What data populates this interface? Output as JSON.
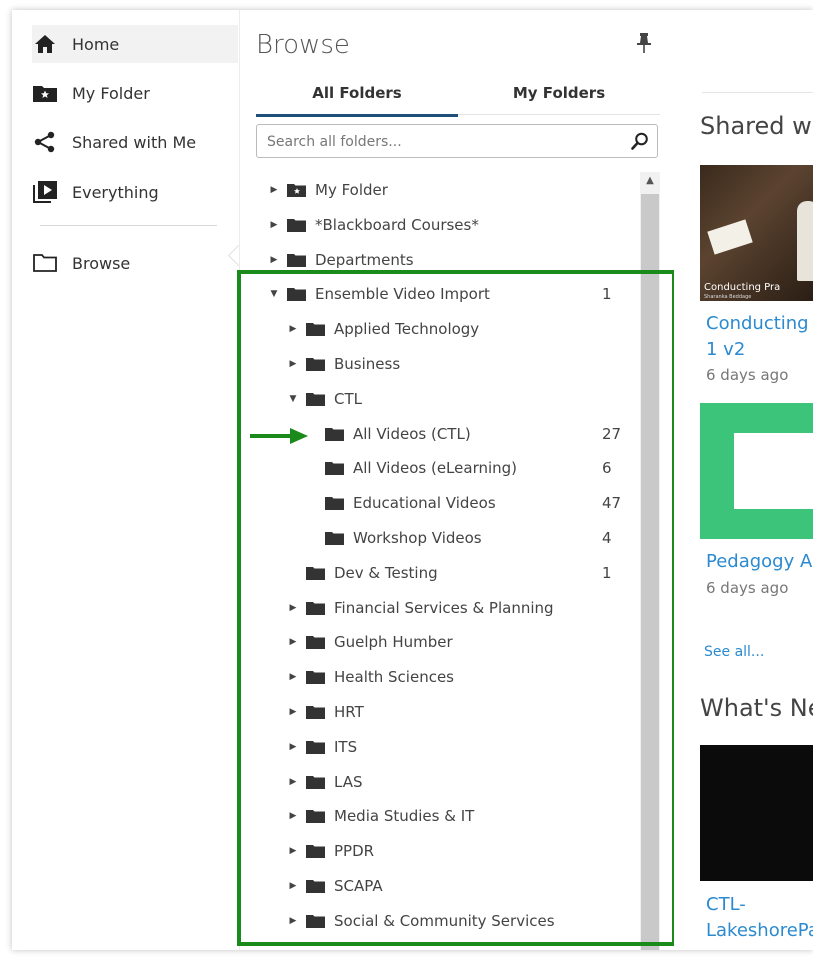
{
  "nav": {
    "items": [
      {
        "label": "Home",
        "icon": "home-icon"
      },
      {
        "label": "My Folder",
        "icon": "star-folder-icon"
      },
      {
        "label": "Shared with Me",
        "icon": "share-icon"
      },
      {
        "label": "Everything",
        "icon": "video-library-icon"
      },
      {
        "label": "Browse",
        "icon": "folder-outline-icon"
      }
    ]
  },
  "panel": {
    "title": "Browse",
    "tabs": [
      {
        "label": "All Folders",
        "active": true
      },
      {
        "label": "My Folders",
        "active": false
      }
    ],
    "search_placeholder": "Search all folders..."
  },
  "tree": [
    {
      "label": "My Folder",
      "count": "",
      "expander": "collapsed",
      "depth": 0,
      "star": true
    },
    {
      "label": "*Blackboard Courses*",
      "count": "",
      "expander": "collapsed",
      "depth": 0
    },
    {
      "label": "Departments",
      "count": "",
      "expander": "collapsed",
      "depth": 0
    },
    {
      "label": "Ensemble Video Import",
      "count": "1",
      "expander": "expanded",
      "depth": 0
    },
    {
      "label": "Applied Technology",
      "count": "",
      "expander": "collapsed",
      "depth": 1
    },
    {
      "label": "Business",
      "count": "",
      "expander": "collapsed",
      "depth": 1
    },
    {
      "label": "CTL",
      "count": "",
      "expander": "expanded",
      "depth": 1
    },
    {
      "label": "All Videos (CTL)",
      "count": "27",
      "expander": "none",
      "depth": 2
    },
    {
      "label": "All Videos (eLearning)",
      "count": "6",
      "expander": "none",
      "depth": 2
    },
    {
      "label": "Educational Videos",
      "count": "47",
      "expander": "none",
      "depth": 2
    },
    {
      "label": "Workshop Videos",
      "count": "4",
      "expander": "none",
      "depth": 2
    },
    {
      "label": "Dev & Testing",
      "count": "1",
      "expander": "none",
      "depth": 1
    },
    {
      "label": "Financial Services & Planning",
      "count": "",
      "expander": "collapsed",
      "depth": 1
    },
    {
      "label": "Guelph Humber",
      "count": "",
      "expander": "collapsed",
      "depth": 1
    },
    {
      "label": "Health Sciences",
      "count": "",
      "expander": "collapsed",
      "depth": 1
    },
    {
      "label": "HRT",
      "count": "",
      "expander": "collapsed",
      "depth": 1
    },
    {
      "label": "ITS",
      "count": "",
      "expander": "collapsed",
      "depth": 1
    },
    {
      "label": "LAS",
      "count": "",
      "expander": "collapsed",
      "depth": 1
    },
    {
      "label": "Media Studies & IT",
      "count": "",
      "expander": "collapsed",
      "depth": 1
    },
    {
      "label": "PPDR",
      "count": "",
      "expander": "collapsed",
      "depth": 1
    },
    {
      "label": "SCAPA",
      "count": "",
      "expander": "collapsed",
      "depth": 1
    },
    {
      "label": "Social & Community Services",
      "count": "",
      "expander": "collapsed",
      "depth": 1
    }
  ],
  "content": {
    "shared_heading": "Shared wi",
    "video1_caption": "Conducting Pra",
    "video1_sub": "Sharanka Beddage",
    "video1_title_line1": "Conducting",
    "video1_title_line2": "1 v2",
    "video1_meta": "6 days ago",
    "video2_title": "Pedagogy A",
    "video2_meta": "6 days ago",
    "see_all": "See all...",
    "whats_new_heading": "What's Ne",
    "video3_title_line1": "CTL-",
    "video3_title_line2": "LakeshorePa"
  },
  "colors": {
    "tab_underline": "#1f4e79",
    "highlight": "#1a8a1a",
    "link": "#2b8ad0",
    "thumb_green": "#3cc57a"
  }
}
